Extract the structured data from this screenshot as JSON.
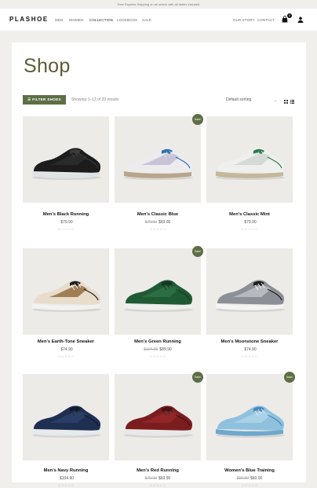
{
  "topbar": {
    "text": "Free Express Shipping on all orders with all duties included"
  },
  "header": {
    "logo": "PLASHOE",
    "nav_left": [
      "MEN",
      "WOMEN",
      "COLLECTION",
      "LOOKBOOK",
      "SALE"
    ],
    "nav_right": [
      "OUR STORY",
      "CONTACT"
    ],
    "cart_count": "0",
    "active_nav": "COLLECTION"
  },
  "shop": {
    "title": "Shop",
    "filter_label": "FILTER SHOES",
    "showing": "Showing 1–12 of 20 results",
    "sort_selected": "Default sorting"
  },
  "colors": {
    "accent": "#5e6e45",
    "title": "#5d5b37",
    "page_bg": "#f0efec",
    "image_bg": "#ecebe8"
  },
  "sale_label": "Sale!",
  "rating_stars": "☆☆☆☆☆",
  "products": [
    {
      "name": "Men's Black Running",
      "price": "$79.90",
      "old_price": "",
      "sale": false,
      "shoe": "black-runner"
    },
    {
      "name": "Men's Classic Blue",
      "price": "$69.00",
      "old_price": "$79.90",
      "sale": true,
      "shoe": "white-blue"
    },
    {
      "name": "Men's Classic Mint",
      "price": "$79.90",
      "old_price": "",
      "sale": false,
      "shoe": "white-green"
    },
    {
      "name": "Men's Earth-Tone Sneaker",
      "price": "$74.90",
      "old_price": "",
      "sale": false,
      "shoe": "earth-tone"
    },
    {
      "name": "Men's Green Running",
      "price": "$89.90",
      "old_price": "$104.90",
      "sale": true,
      "shoe": "green-runner"
    },
    {
      "name": "Men's Moonstone Sneaker",
      "price": "$74.90",
      "old_price": "",
      "sale": false,
      "shoe": "moonstone"
    },
    {
      "name": "Men's Navy Running",
      "price": "$104.90",
      "old_price": "",
      "sale": false,
      "shoe": "navy-runner"
    },
    {
      "name": "Men's Red Running",
      "price": "$69.90",
      "old_price": "$79.90",
      "sale": true,
      "shoe": "red-runner"
    },
    {
      "name": "Women's Blue Training",
      "price": "$60.00",
      "old_price": "$69.90",
      "sale": true,
      "shoe": "blue-training"
    }
  ]
}
